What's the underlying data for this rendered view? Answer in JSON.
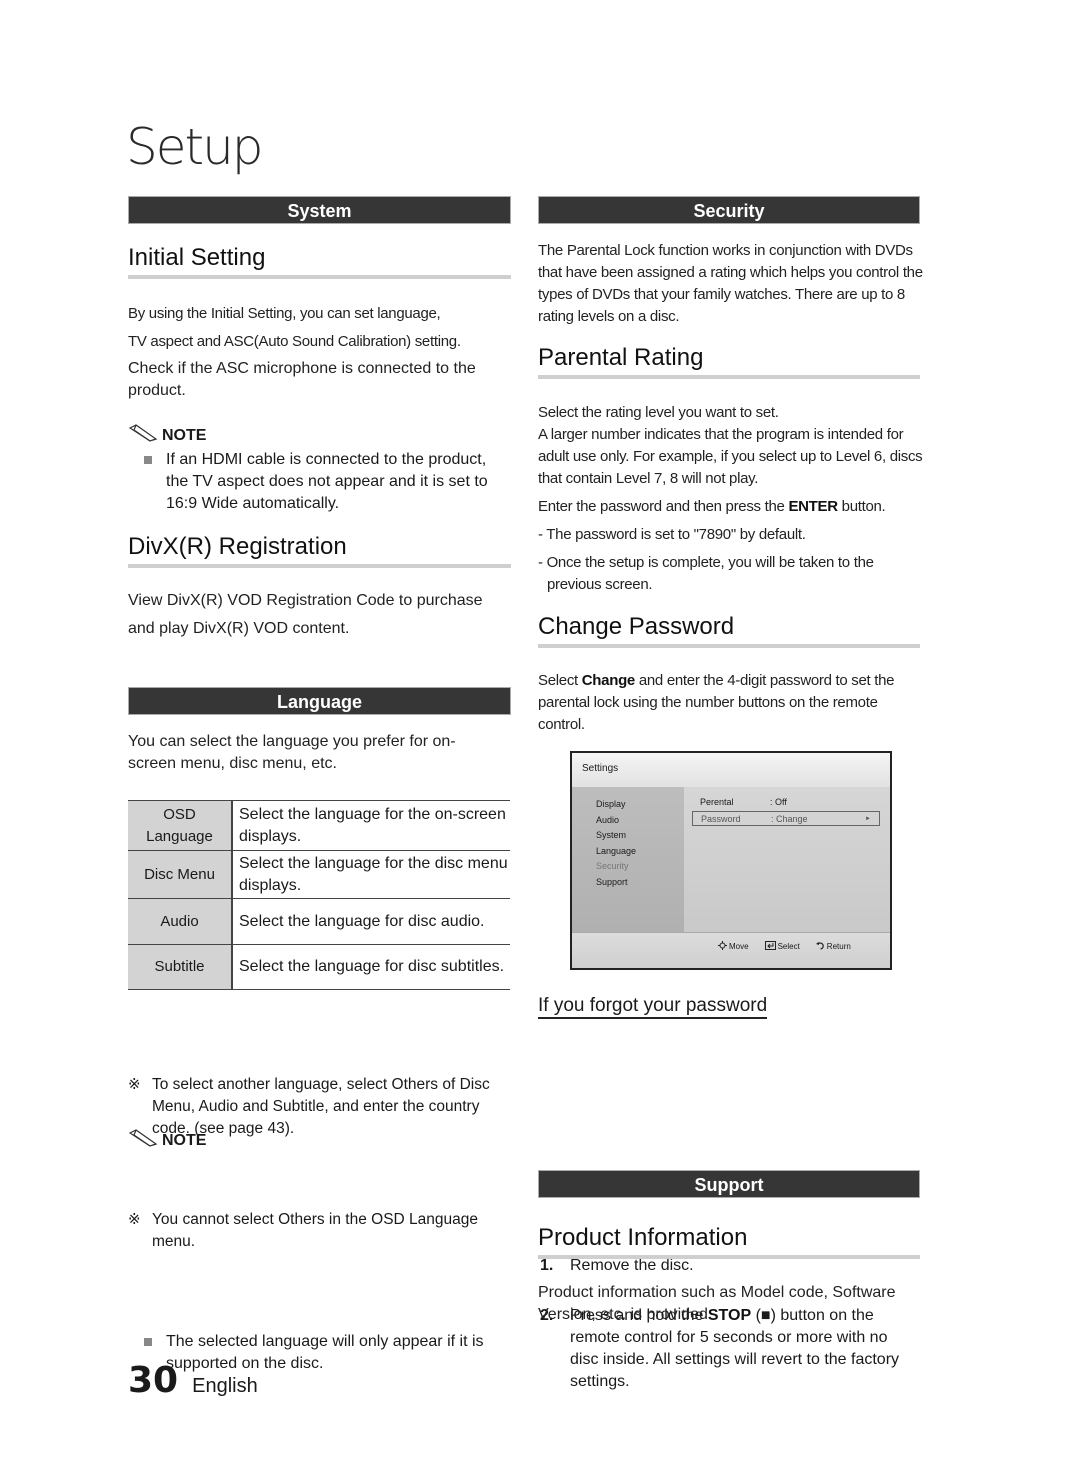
{
  "page": {
    "title": "Setup",
    "page_number": "30",
    "language": "English"
  },
  "left": {
    "system_bar": "System",
    "initial_setting": {
      "heading": "Initial Setting",
      "p1": "By using the Initial Setting, you can set language,",
      "p2": "TV aspect and ASC(Auto Sound Calibration) setting.",
      "p3": "Check if the ASC microphone is connected to the product.",
      "note_label": "NOTE",
      "note_item": "If an HDMI cable is connected to the product, the TV aspect does not appear and it is set to 16:9 Wide automatically."
    },
    "divx": {
      "heading": "DivX(R) Registration",
      "p1": "View DivX(R) VOD Registration Code to purchase",
      "p2": "and play DivX(R) VOD content."
    },
    "language_bar": "Language",
    "language": {
      "intro": "You can select the language you prefer for on-screen menu, disc menu, etc.",
      "table": [
        {
          "key": "OSD Language",
          "value": "Select the language for the on-screen displays."
        },
        {
          "key": "Disc Menu",
          "value": "Select the language for the disc menu displays."
        },
        {
          "key": "Audio",
          "value": "Select the language for disc audio."
        },
        {
          "key": "Subtitle",
          "value": "Select the language for disc subtitles."
        }
      ],
      "star_mark": "※",
      "star1": "To select another language, select Others of Disc Menu, Audio and Subtitle, and enter the country code. (see page 43).",
      "star2": "You cannot select Others in the OSD Language menu.",
      "note_label": "NOTE",
      "note_item": "The selected language will only appear if it is supported on the disc."
    }
  },
  "right": {
    "security_bar": "Security",
    "security_intro": "The Parental Lock function works in conjunction with DVDs that have been assigned a rating which helps you control the types of DVDs that your family watches. There are up to 8 rating levels on a disc.",
    "parental": {
      "heading": "Parental Rating",
      "p1": "Select the rating level you want to set.",
      "p2": "A larger number indicates that the program is intended for adult use only. For example, if you select up to Level 6, discs that contain Level 7, 8 will not play.",
      "p3_pre": "Enter the password and then press the ",
      "p3_bold": "ENTER",
      "p3_post": " button.",
      "dash1": "- The password is set to \"7890\" by default.",
      "dash2": "- Once the setup is complete, you will be taken to the previous screen."
    },
    "change_password": {
      "heading": "Change Password",
      "p_pre": "Select ",
      "p_bold": "Change",
      "p_post": " and enter the 4-digit password to set the parental lock using the number buttons on the remote control."
    },
    "tv_screen": {
      "title": "Settings",
      "menu": [
        "Display",
        "Audio",
        "System",
        "Language",
        "Security",
        "Support"
      ],
      "active_menu": "Security",
      "rows": [
        {
          "label": "Perental",
          "value": ": Off"
        },
        {
          "label": "Password",
          "value": ": Change",
          "arrow": "►"
        }
      ],
      "footer": [
        {
          "icon": "move-icon",
          "label": "Move"
        },
        {
          "icon": "enter-icon",
          "label": "Select"
        },
        {
          "icon": "return-icon",
          "label": "Return"
        }
      ]
    },
    "forgot": {
      "heading": "If you forgot your password",
      "steps": [
        {
          "num": "1.",
          "text": "Remove the disc."
        },
        {
          "num": "2.",
          "pre": "Press and hold the ",
          "bold": "STOP",
          "post": " (■) button on the remote control for 5 seconds or more with no disc inside. All settings will revert to the factory settings."
        }
      ]
    },
    "support_bar": "Support",
    "product_info": {
      "heading": "Product Information",
      "p": "Product information such as Model code, Software Version, etc. is provided."
    }
  }
}
